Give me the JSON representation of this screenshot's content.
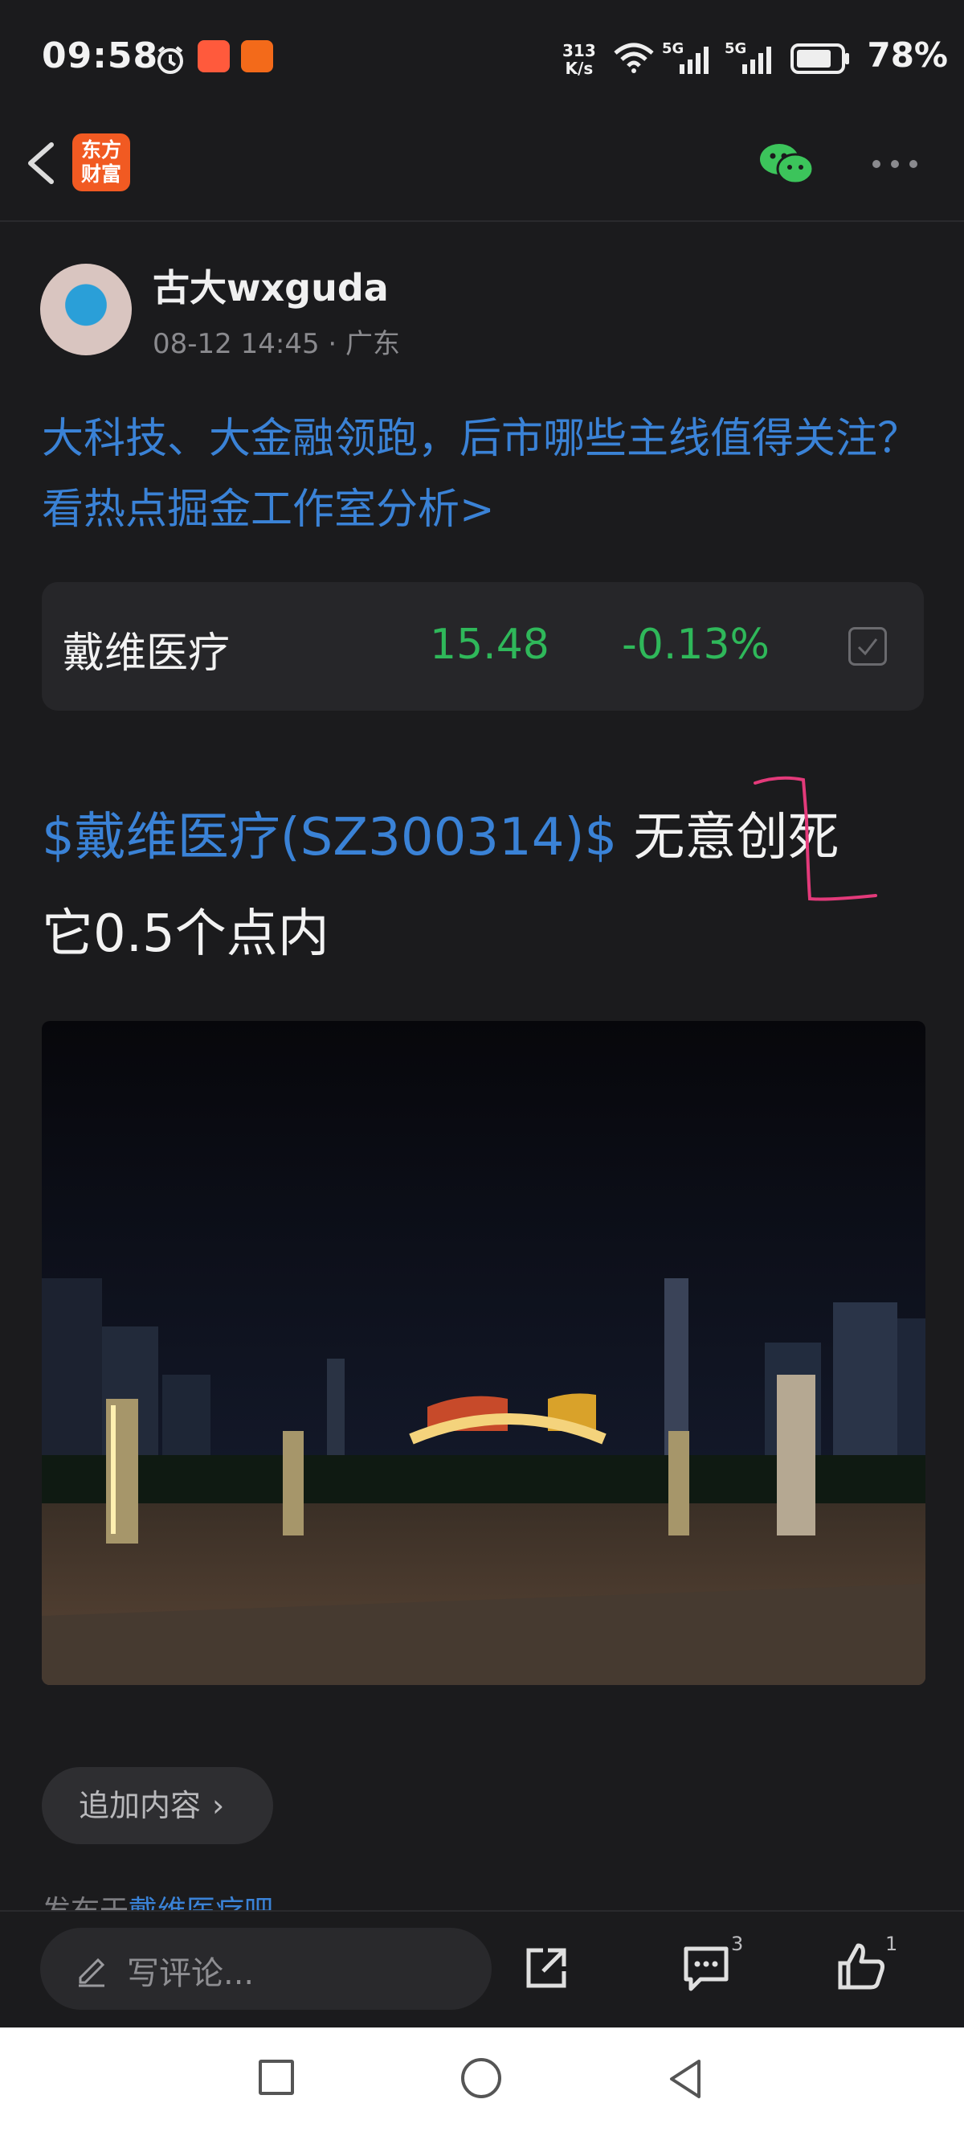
{
  "status_bar": {
    "time": "09:58",
    "net_speed_value": "313",
    "net_speed_unit": "K/s",
    "signal_1": "5G",
    "signal_2": "5G",
    "battery": "78%"
  },
  "nav": {
    "logo_line1": "东方",
    "logo_line2": "财富",
    "icons": [
      "back-arrow-icon",
      "wechat-icon",
      "more-icon"
    ]
  },
  "post": {
    "author": "古大wxguda",
    "meta": "08-12 14:45 · 广东",
    "promo": "大科技、大金融领跑，后市哪些主线值得关注？看热点掘金工作室分析>",
    "stock_card": {
      "name": "戴维医疗",
      "price": "15.48",
      "change": "-0.13%",
      "color": "#2fb85a"
    },
    "content_link": "$戴维医疗(SZ300314)$",
    "content_text1": "无意创死",
    "content_text2": "它0.5个点内",
    "append_label": "追加内容",
    "posted_prefix": "发布于",
    "posted_bar": "戴维医疗吧"
  },
  "bottom": {
    "comment_placeholder": "写评论...",
    "comment_count": "3",
    "like_count": "1"
  },
  "colors": {
    "background": "#1b1b1d",
    "link": "#3a82d6",
    "down": "#2fb85a",
    "brand": "#f15a22"
  }
}
